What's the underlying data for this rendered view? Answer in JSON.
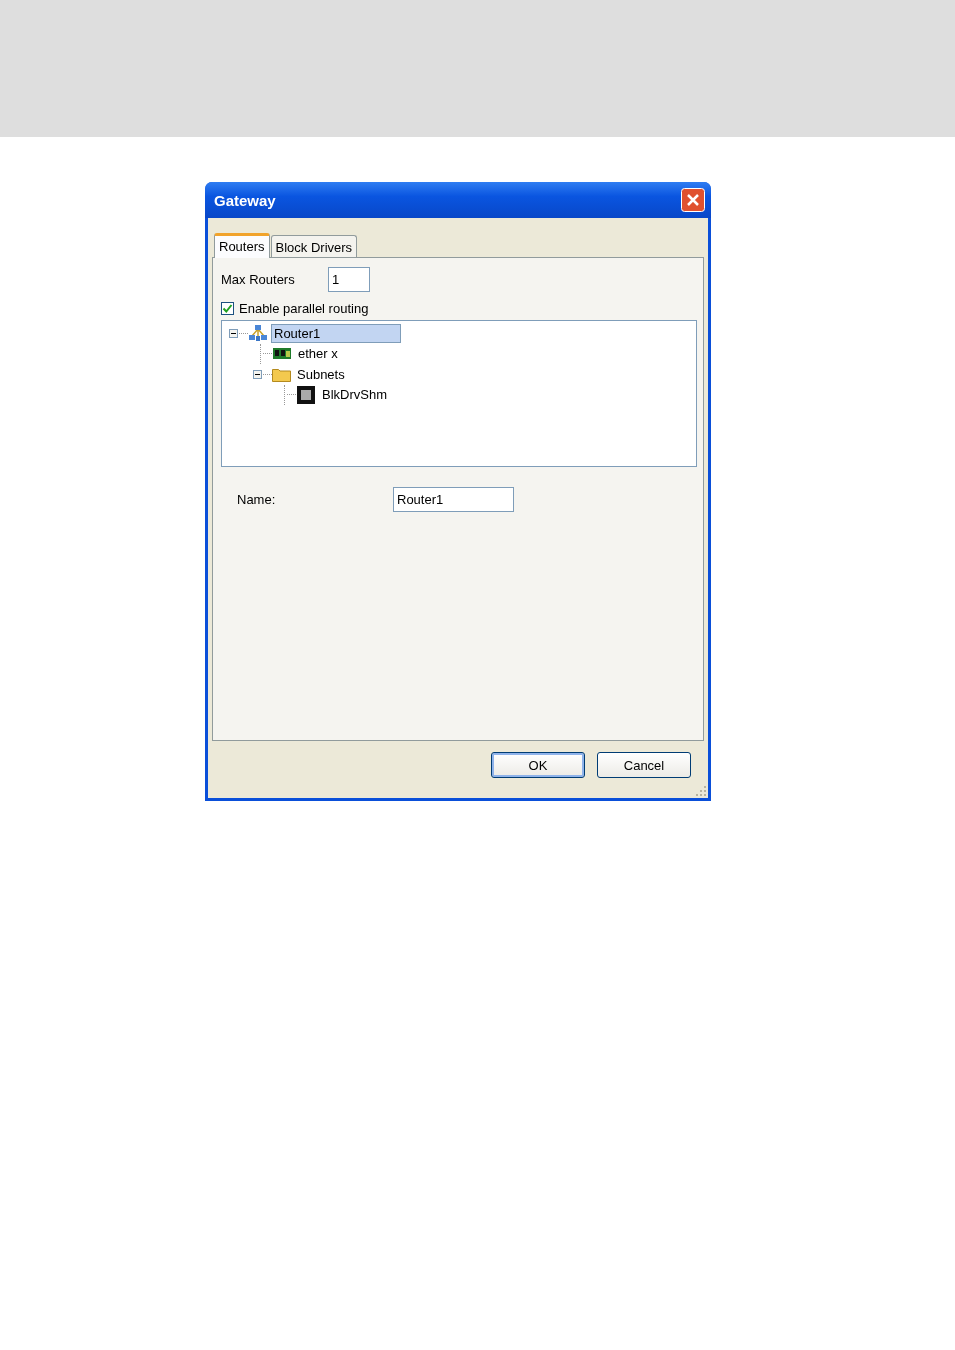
{
  "window": {
    "title": "Gateway"
  },
  "tabs": [
    {
      "label": "Routers",
      "selected": true
    },
    {
      "label": "Block Drivers",
      "selected": false
    }
  ],
  "max_routers": {
    "label": "Max Routers",
    "value": "1"
  },
  "parallel_routing": {
    "label": "Enable parallel routing",
    "checked": true
  },
  "tree": [
    {
      "label": "Router1",
      "kind": "router",
      "selected": true,
      "expanded": true,
      "children": [
        {
          "label": "ether x",
          "kind": "nic",
          "selected": false
        },
        {
          "label": "Subnets",
          "kind": "folder",
          "selected": false,
          "expanded": true,
          "children": [
            {
              "label": "BlkDrvShm",
              "kind": "chip",
              "selected": false
            }
          ]
        }
      ]
    }
  ],
  "name_field": {
    "label": "Name:",
    "value": "Router1"
  },
  "buttons": [
    {
      "label": "OK",
      "kind": "default"
    },
    {
      "label": "Cancel",
      "kind": "normal"
    }
  ]
}
